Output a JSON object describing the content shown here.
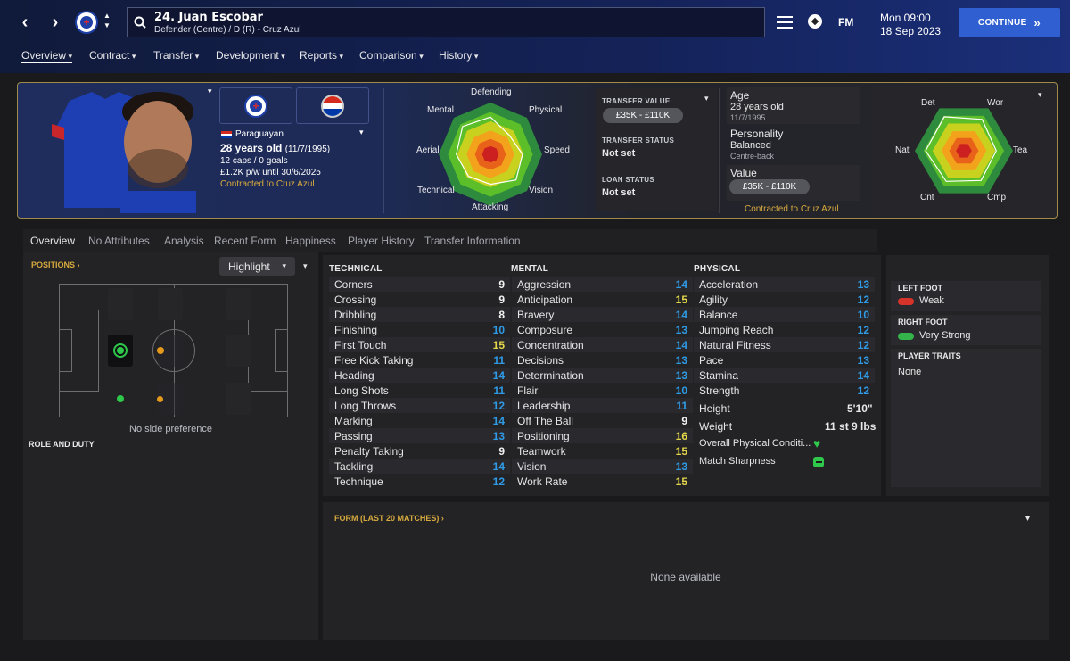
{
  "topbar": {
    "player_title": "24. Juan Escobar",
    "player_subtitle": "Defender (Centre) / D (R) - Cruz Azul",
    "date_time": "Mon 09:00",
    "date": "18 Sep 2023",
    "continue_label": "CONTINUE",
    "fm_label": "FM"
  },
  "menu": [
    "Overview",
    "Contract",
    "Transfer",
    "Development",
    "Reports",
    "Comparison",
    "History"
  ],
  "profile": {
    "nationality": "Paraguayan",
    "age_line": "28 years old",
    "dob_paren": "(11/7/1995)",
    "caps": "12 caps / 0 goals",
    "wage": "£1.2K p/w until 30/6/2025",
    "contract": "Contracted to Cruz Azul"
  },
  "radar1": {
    "labels": [
      "Defending",
      "Physical",
      "Speed",
      "Vision",
      "Attacking",
      "Technical",
      "Aerial",
      "Mental"
    ],
    "shape": [
      0.72,
      0.52,
      0.62,
      0.7,
      0.58,
      0.6,
      0.66,
      0.76
    ]
  },
  "transfer": {
    "value_label": "TRANSFER VALUE",
    "value": "£35K - £110K",
    "status_label": "TRANSFER STATUS",
    "status": "Not set",
    "loan_label": "LOAN STATUS",
    "loan": "Not set"
  },
  "info": {
    "age_label": "Age",
    "age": "28 years old",
    "dob": "11/7/1995",
    "personality_label": "Personality",
    "personality": "Balanced",
    "role": "Centre-back",
    "value_label": "Value",
    "value": "£35K - £110K",
    "contract": "Contracted to Cruz Azul"
  },
  "radar2": {
    "labels": [
      "Wor",
      "Tea",
      "Cmp",
      "Cnt",
      "Nat",
      "Det"
    ],
    "shape": [
      0.74,
      0.66,
      0.7,
      0.72,
      0.78,
      0.8
    ]
  },
  "tabs": [
    "Overview",
    "No Attributes",
    "Analysis",
    "Recent Form",
    "Happiness",
    "Player History",
    "Transfer Information"
  ],
  "positions": {
    "title": "POSITIONS",
    "highlight": "Highlight",
    "side_pref": "No side preference",
    "role_title": "ROLE AND DUTY"
  },
  "technical": {
    "title": "TECHNICAL",
    "rows": [
      [
        "Corners",
        9
      ],
      [
        "Crossing",
        9
      ],
      [
        "Dribbling",
        8
      ],
      [
        "Finishing",
        10
      ],
      [
        "First Touch",
        15
      ],
      [
        "Free Kick Taking",
        11
      ],
      [
        "Heading",
        14
      ],
      [
        "Long Shots",
        11
      ],
      [
        "Long Throws",
        12
      ],
      [
        "Marking",
        14
      ],
      [
        "Passing",
        13
      ],
      [
        "Penalty Taking",
        9
      ],
      [
        "Tackling",
        14
      ],
      [
        "Technique",
        12
      ]
    ]
  },
  "mental": {
    "title": "MENTAL",
    "rows": [
      [
        "Aggression",
        14
      ],
      [
        "Anticipation",
        15
      ],
      [
        "Bravery",
        14
      ],
      [
        "Composure",
        13
      ],
      [
        "Concentration",
        14
      ],
      [
        "Decisions",
        13
      ],
      [
        "Determination",
        13
      ],
      [
        "Flair",
        10
      ],
      [
        "Leadership",
        11
      ],
      [
        "Off The Ball",
        9
      ],
      [
        "Positioning",
        16
      ],
      [
        "Teamwork",
        15
      ],
      [
        "Vision",
        13
      ],
      [
        "Work Rate",
        15
      ]
    ]
  },
  "physical": {
    "title": "PHYSICAL",
    "rows": [
      [
        "Acceleration",
        13
      ],
      [
        "Agility",
        12
      ],
      [
        "Balance",
        10
      ],
      [
        "Jumping Reach",
        12
      ],
      [
        "Natural Fitness",
        12
      ],
      [
        "Pace",
        13
      ],
      [
        "Stamina",
        14
      ],
      [
        "Strength",
        12
      ]
    ],
    "height_label": "Height",
    "height": "5'10\"",
    "weight_label": "Weight",
    "weight": "11 st 9 lbs",
    "fitness_label": "Overall Physical Conditi...",
    "sharpness_label": "Match Sharpness"
  },
  "feet": {
    "left_title": "LEFT FOOT",
    "left": "Weak",
    "right_title": "RIGHT FOOT",
    "right": "Very Strong",
    "traits_title": "PLAYER TRAITS",
    "traits": "None"
  },
  "form": {
    "title": "FORM (LAST 20 MATCHES)",
    "empty": "None available"
  }
}
